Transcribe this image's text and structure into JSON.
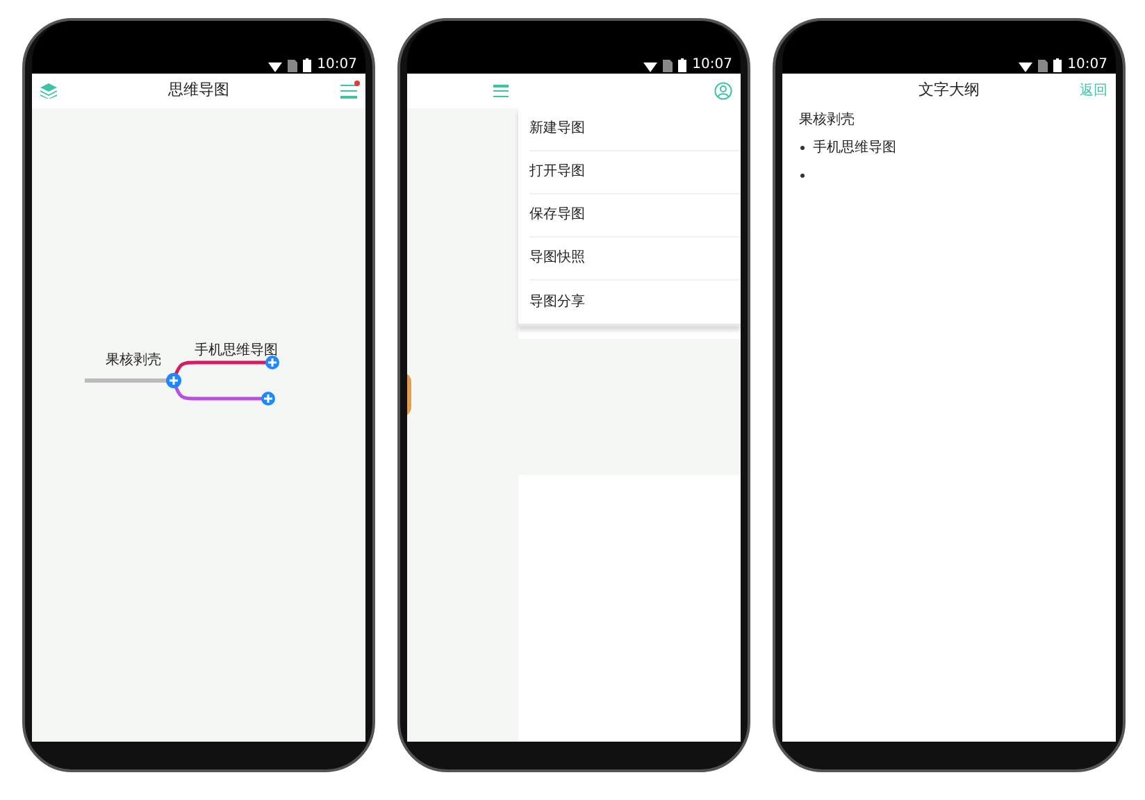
{
  "phones": [
    {
      "kind": "mindmap",
      "status_time": "10:07",
      "title": "思维导图",
      "notification": true,
      "root": "果核剥壳",
      "branches": [
        {
          "label": "手机思维导图",
          "color": "#d81b60"
        },
        {
          "color": "#b84fe0"
        }
      ]
    },
    {
      "kind": "menu",
      "status_time": "10:07",
      "menu": [
        "新建导图",
        "打开导图",
        "保存导图",
        "导图快照",
        "导图分享"
      ]
    },
    {
      "kind": "outline",
      "status_time": "10:07",
      "title": "文字大纲",
      "back": "返回",
      "root": "果核剥壳",
      "items": [
        {
          "kind": "bullet",
          "label": "手机思维导图"
        },
        {
          "kind": "bullet"
        }
      ]
    }
  ]
}
